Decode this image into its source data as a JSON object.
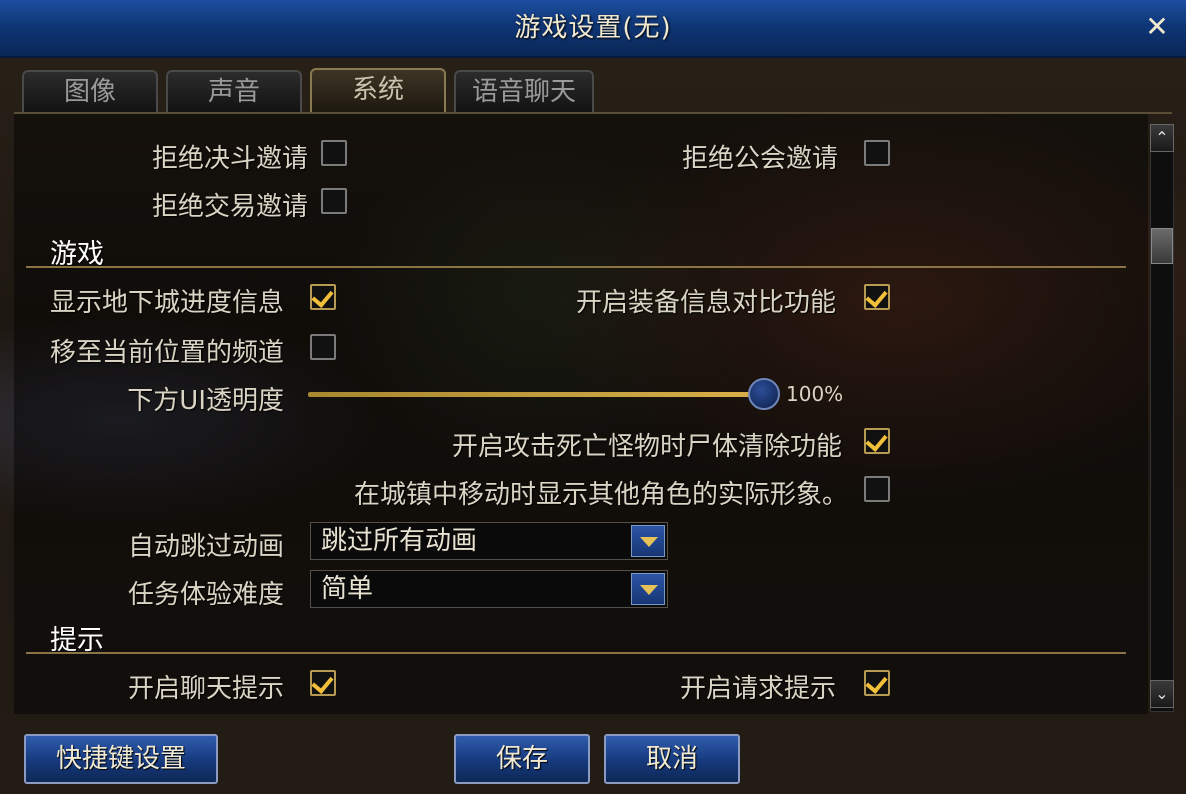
{
  "window": {
    "title": "游戏设置(无)",
    "close_symbol": "✕"
  },
  "tabs": [
    "图像",
    "声音",
    "系统",
    "语音聊天"
  ],
  "active_tab": "系统",
  "social": {
    "reject_duel": {
      "label": "拒绝决斗邀请",
      "checked": false
    },
    "reject_guild": {
      "label": "拒绝公会邀请",
      "checked": false
    },
    "reject_trade": {
      "label": "拒绝交易邀请",
      "checked": false
    }
  },
  "game": {
    "section_title": "游戏",
    "dungeon_progress": {
      "label": "显示地下城进度信息",
      "checked": true
    },
    "equip_compare": {
      "label": "开启装备信息对比功能",
      "checked": true
    },
    "move_channel": {
      "label": "移至当前位置的频道",
      "checked": false
    },
    "ui_opacity": {
      "label": "下方UI透明度",
      "value": 100,
      "value_text": "100%"
    },
    "corpse_clear": {
      "label": "开启攻击死亡怪物时尸体清除功能",
      "checked": true
    },
    "show_real_appearance": {
      "label": "在城镇中移动时显示其他角色的实际形象。",
      "checked": false
    },
    "skip_animation": {
      "label": "自动跳过动画",
      "selected": "跳过所有动画"
    },
    "quest_difficulty": {
      "label": "任务体验难度",
      "selected": "简单"
    }
  },
  "hints": {
    "section_title": "提示",
    "chat_hint": {
      "label": "开启聊天提示",
      "checked": true
    },
    "request_hint": {
      "label": "开启请求提示",
      "checked": true
    }
  },
  "footer": {
    "shortcut_label": "快捷键设置",
    "save_label": "保存",
    "cancel_label": "取消"
  },
  "colors": {
    "accent": "#f2bf3a",
    "title_bar": "#0f3677",
    "button": "#16397c"
  }
}
